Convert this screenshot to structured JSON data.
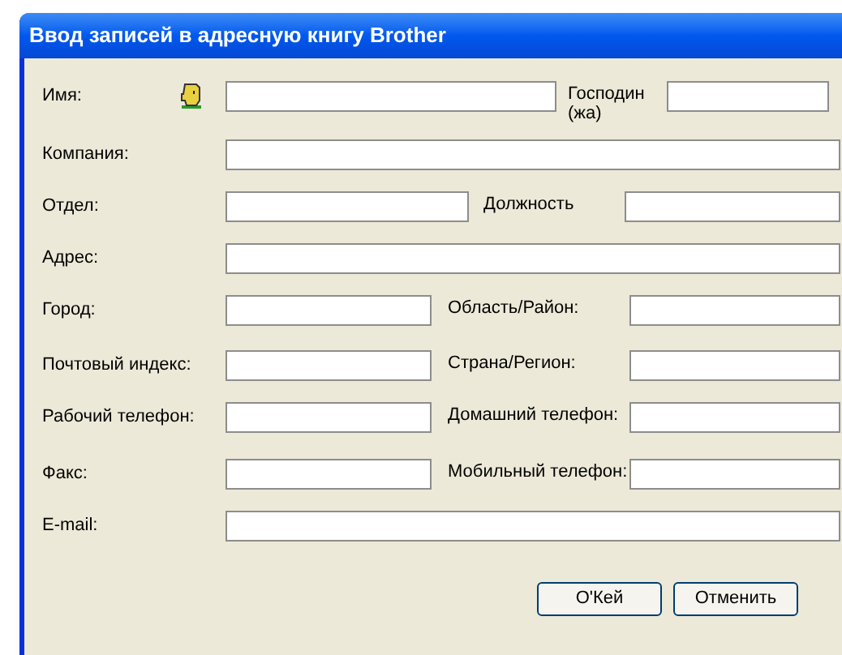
{
  "window": {
    "title": "Ввод записей в адресную книгу Brother"
  },
  "rows": [
    {
      "kind": "name",
      "label": "Имя:",
      "label2": "Господин (жа)"
    },
    {
      "kind": "wide",
      "label": "Компания:"
    },
    {
      "kind": "pair-wide",
      "label": "Отдел:",
      "label2": "Должность"
    },
    {
      "kind": "wide",
      "label": "Адрес:"
    },
    {
      "kind": "pair",
      "label": "Город:",
      "label2": "Область/Район:"
    },
    {
      "kind": "pair",
      "label": "Почтовый индекс:",
      "label2": "Страна/Регион:"
    },
    {
      "kind": "pair",
      "label": "Рабочий телефон:",
      "label2": "Домашний телефон:"
    },
    {
      "kind": "pair",
      "label": "Факс:",
      "label2": "Мобильный телефон:"
    },
    {
      "kind": "wide",
      "label": "E-mail:"
    }
  ],
  "buttons": [
    "O'Кей",
    "Отменить"
  ]
}
